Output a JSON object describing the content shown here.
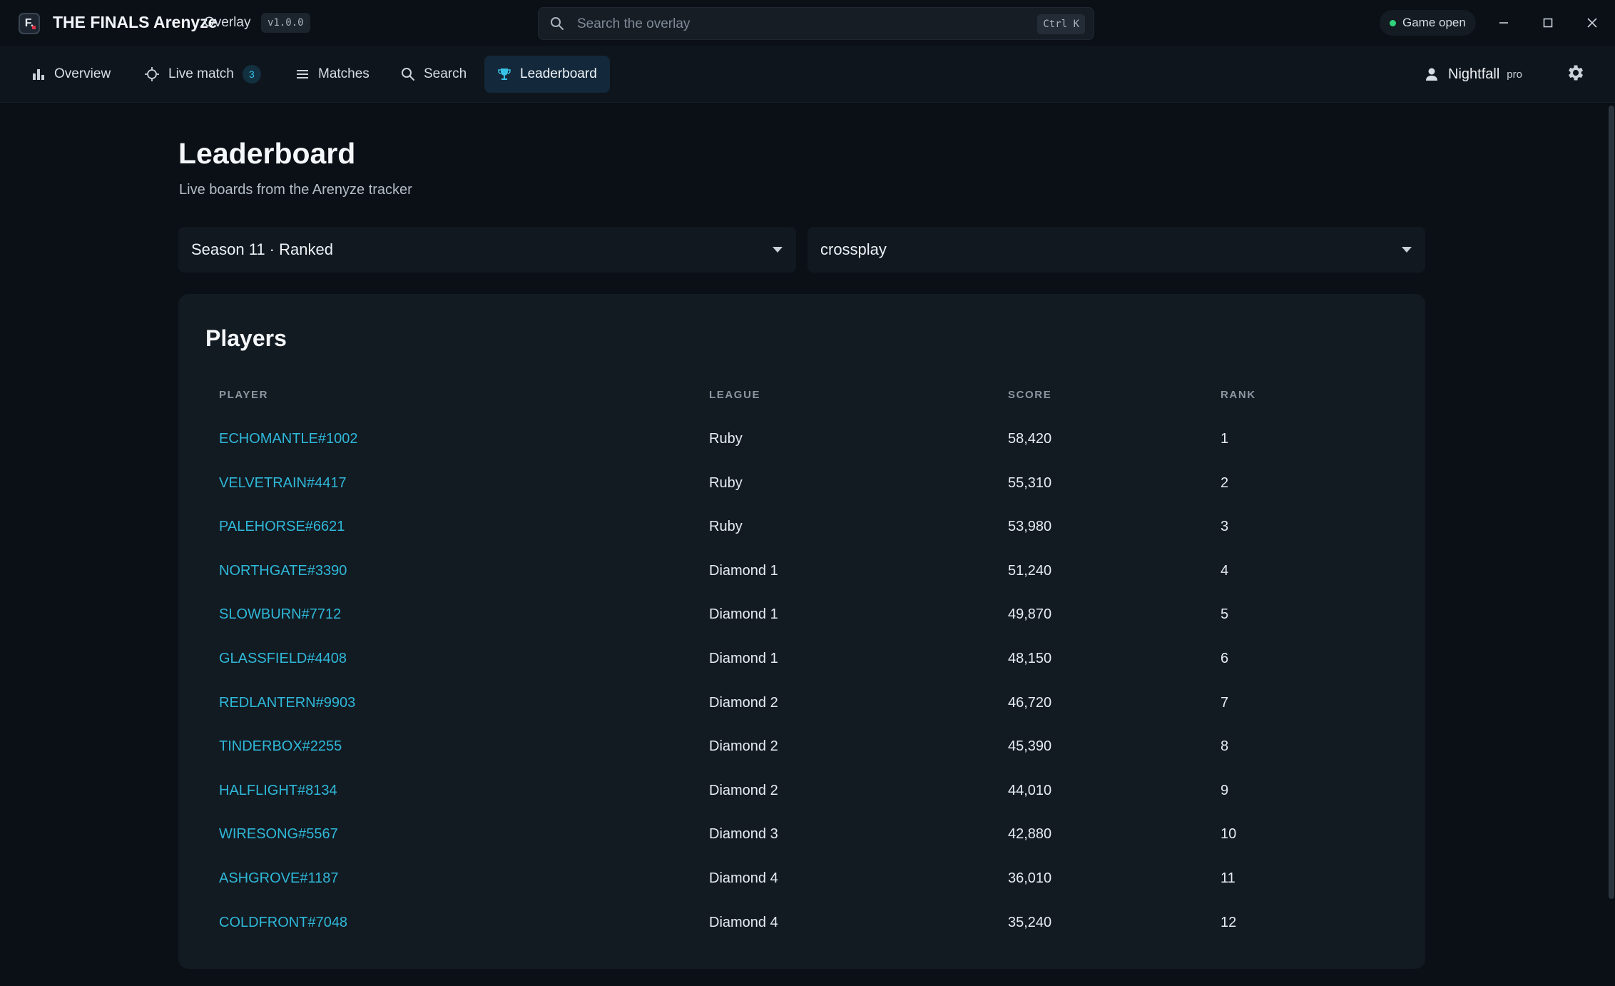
{
  "app": {
    "title": "THE FINALS Arenyze",
    "subtitle": "Overlay",
    "version": "v1.0.0",
    "logo_letter": "F."
  },
  "search": {
    "placeholder": "Search the overlay",
    "shortcut": "Ctrl K"
  },
  "status": {
    "label": "Game open",
    "color": "#2fd47a"
  },
  "nav": {
    "items": [
      {
        "label": "Overview",
        "icon": "bar-chart-icon"
      },
      {
        "label": "Live match",
        "icon": "crosshair-icon",
        "badge": "3"
      },
      {
        "label": "Matches",
        "icon": "list-icon"
      },
      {
        "label": "Search",
        "icon": "search-icon"
      },
      {
        "label": "Leaderboard",
        "icon": "trophy-icon",
        "active": true
      }
    ]
  },
  "user": {
    "name": "Nightfall",
    "tier": "pro"
  },
  "page": {
    "title": "Leaderboard",
    "subtitle": "Live boards from the Arenyze tracker"
  },
  "filters": {
    "season": "Season 11 · Ranked",
    "platform": "crossplay"
  },
  "players": {
    "title": "Players",
    "columns": [
      "PLAYER",
      "LEAGUE",
      "SCORE",
      "RANK"
    ],
    "rows": [
      {
        "player": "ECHOMANTLE#1002",
        "league": "Ruby",
        "score": "58,420",
        "rank": "1"
      },
      {
        "player": "VELVETRAIN#4417",
        "league": "Ruby",
        "score": "55,310",
        "rank": "2"
      },
      {
        "player": "PALEHORSE#6621",
        "league": "Ruby",
        "score": "53,980",
        "rank": "3"
      },
      {
        "player": "NORTHGATE#3390",
        "league": "Diamond 1",
        "score": "51,240",
        "rank": "4"
      },
      {
        "player": "SLOWBURN#7712",
        "league": "Diamond 1",
        "score": "49,870",
        "rank": "5"
      },
      {
        "player": "GLASSFIELD#4408",
        "league": "Diamond 1",
        "score": "48,150",
        "rank": "6"
      },
      {
        "player": "REDLANTERN#9903",
        "league": "Diamond 2",
        "score": "46,720",
        "rank": "7"
      },
      {
        "player": "TINDERBOX#2255",
        "league": "Diamond 2",
        "score": "45,390",
        "rank": "8"
      },
      {
        "player": "HALFLIGHT#8134",
        "league": "Diamond 2",
        "score": "44,010",
        "rank": "9"
      },
      {
        "player": "WIRESONG#5567",
        "league": "Diamond 3",
        "score": "42,880",
        "rank": "10"
      },
      {
        "player": "ASHGROVE#1187",
        "league": "Diamond 4",
        "score": "36,010",
        "rank": "11"
      },
      {
        "player": "COLDFRONT#7048",
        "league": "Diamond 4",
        "score": "35,240",
        "rank": "12"
      }
    ]
  },
  "colors": {
    "accent": "#2fb8d8",
    "background": "#0b1016",
    "card": "#121a22",
    "active_tab": "#13283a"
  }
}
